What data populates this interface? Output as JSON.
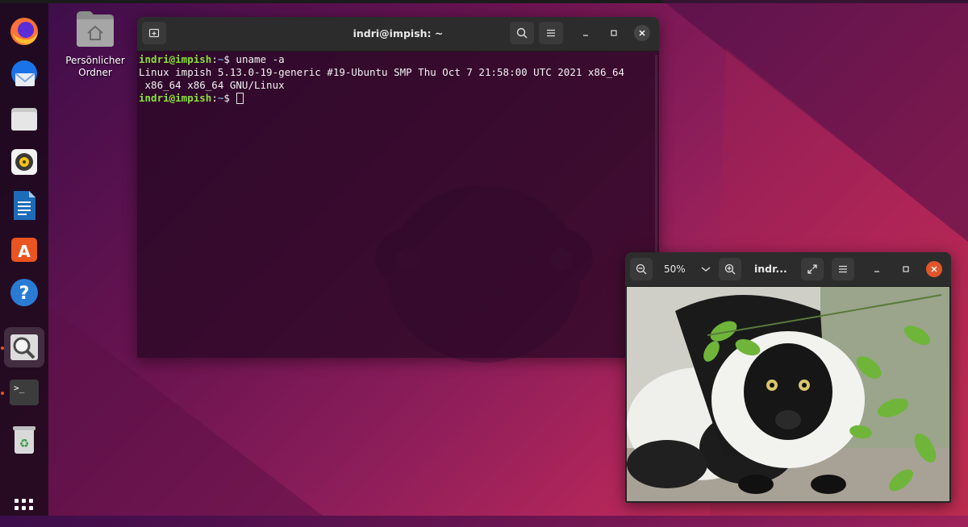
{
  "desktop": {
    "home_folder_label_line1": "Persönlicher",
    "home_folder_label_line2": "Ordner"
  },
  "dock": {
    "items": [
      {
        "name": "Firefox",
        "icon": "firefox-icon"
      },
      {
        "name": "Thunderbird",
        "icon": "thunderbird-icon"
      },
      {
        "name": "Files",
        "icon": "files-icon"
      },
      {
        "name": "Rhythmbox",
        "icon": "rhythmbox-icon"
      },
      {
        "name": "LibreOffice Writer",
        "icon": "writer-icon"
      },
      {
        "name": "Ubuntu Software",
        "icon": "software-icon"
      },
      {
        "name": "Help",
        "icon": "help-icon"
      },
      {
        "name": "Image Viewer",
        "icon": "image-viewer-icon",
        "running": true,
        "active": true
      },
      {
        "name": "Terminal",
        "icon": "terminal-icon",
        "running": true
      },
      {
        "name": "Trash",
        "icon": "trash-icon"
      },
      {
        "name": "Show Applications",
        "icon": "app-grid-icon"
      }
    ]
  },
  "terminal": {
    "title": "indri@impish: ~",
    "lines": [
      {
        "user": "indri@impish",
        "sep": ":",
        "path": "~",
        "symbol": "$",
        "command": " uname -a"
      },
      {
        "output": "Linux impish 5.13.0-19-generic #19-Ubuntu SMP Thu Oct 7 21:58:00 UTC 2021 x86_64"
      },
      {
        "output": " x86_64 x86_64 GNU/Linux"
      },
      {
        "user": "indri@impish",
        "sep": ":",
        "path": "~",
        "symbol": "$",
        "command": " "
      }
    ]
  },
  "viewer": {
    "zoom": "50%",
    "title": "indr..."
  },
  "colors": {
    "prompt_user": "#8ae234",
    "prompt_path": "#729fcf",
    "accent": "#e95420",
    "close_button": "#e0552b"
  }
}
